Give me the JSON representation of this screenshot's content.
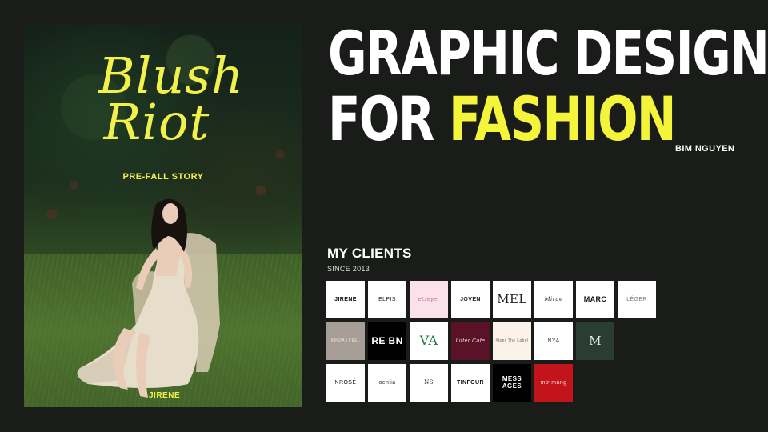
{
  "poster": {
    "title_line1": "Blush",
    "title_line2": "Riot",
    "subtitle": "PRE-FALL STORY",
    "brand": "JIRENE",
    "accent_color": "#f2f04a"
  },
  "headline": {
    "line1": "GRAPHIC DESIGN",
    "line2_prefix": "FOR ",
    "line2_accent": "FASHION",
    "accent_color": "#f4f53a"
  },
  "author": "BIM NGUYEN",
  "clients": {
    "title": "MY CLIENTS",
    "since": "SINCE 2013",
    "rows": [
      [
        {
          "label": "JIRENE",
          "bg": "#ffffff",
          "fg": "#111111",
          "weight": "bold"
        },
        {
          "label": "ELPIS",
          "bg": "#ffffff",
          "fg": "#222222",
          "weight": "normal"
        },
        {
          "label": "eLreyer",
          "bg": "#fbe1ea",
          "fg": "#c4608a",
          "weight": "normal",
          "italic": true
        },
        {
          "label": "JOVEN",
          "bg": "#ffffff",
          "fg": "#222222",
          "weight": "bold"
        },
        {
          "label": "MEL",
          "bg": "#ffffff",
          "fg": "#222222",
          "weight": "normal",
          "size": "15px",
          "serif": true
        },
        {
          "label": "Mirae",
          "bg": "#ffffff",
          "fg": "#333333",
          "weight": "normal",
          "italic": true,
          "serif": true
        },
        {
          "label": "MARC",
          "bg": "#ffffff",
          "fg": "#111111",
          "weight": "bold",
          "size": "9px"
        },
        {
          "label": "LÉGER",
          "bg": "#ffffff",
          "fg": "#777777",
          "weight": "normal"
        }
      ],
      [
        {
          "label": "KINDA I FEEL",
          "bg": "#a79d97",
          "fg": "#efe9e4",
          "weight": "normal",
          "size": "5px"
        },
        {
          "label": "RE BN",
          "bg": "#000000",
          "fg": "#ffffff",
          "weight": "bold",
          "size": "12px"
        },
        {
          "label": "VA",
          "bg": "#ffffff",
          "fg": "#1d7a43",
          "weight": "normal",
          "size": "16px",
          "serif": true
        },
        {
          "label": "Litter Cafe",
          "bg": "#5a1228",
          "fg": "#f1dfe4",
          "weight": "normal",
          "italic": true
        },
        {
          "label": "#Iper The Label",
          "bg": "#fbf3ea",
          "fg": "#7a6a60",
          "weight": "normal",
          "size": "5px"
        },
        {
          "label": "NYA",
          "bg": "#ffffff",
          "fg": "#444444",
          "weight": "normal"
        },
        {
          "label": "M",
          "bg": "#2a3d35",
          "fg": "#e8e8e8",
          "weight": "normal",
          "size": "15px",
          "serif": true
        }
      ],
      [
        {
          "label": "NROSÉ",
          "bg": "#ffffff",
          "fg": "#111111",
          "weight": "normal"
        },
        {
          "label": "oenlia",
          "bg": "#ffffff",
          "fg": "#333333",
          "weight": "normal"
        },
        {
          "label": "NS",
          "bg": "#ffffff",
          "fg": "#111111",
          "weight": "normal",
          "serif": true
        },
        {
          "label": "TINFOUR",
          "bg": "#ffffff",
          "fg": "#111111",
          "weight": "bold"
        },
        {
          "label": "MESS AGES",
          "bg": "#000000",
          "fg": "#ffffff",
          "weight": "bold",
          "size": "8px"
        },
        {
          "label": "mơ màng",
          "bg": "#c4141b",
          "fg": "#f3d6d6",
          "weight": "normal"
        }
      ]
    ]
  }
}
